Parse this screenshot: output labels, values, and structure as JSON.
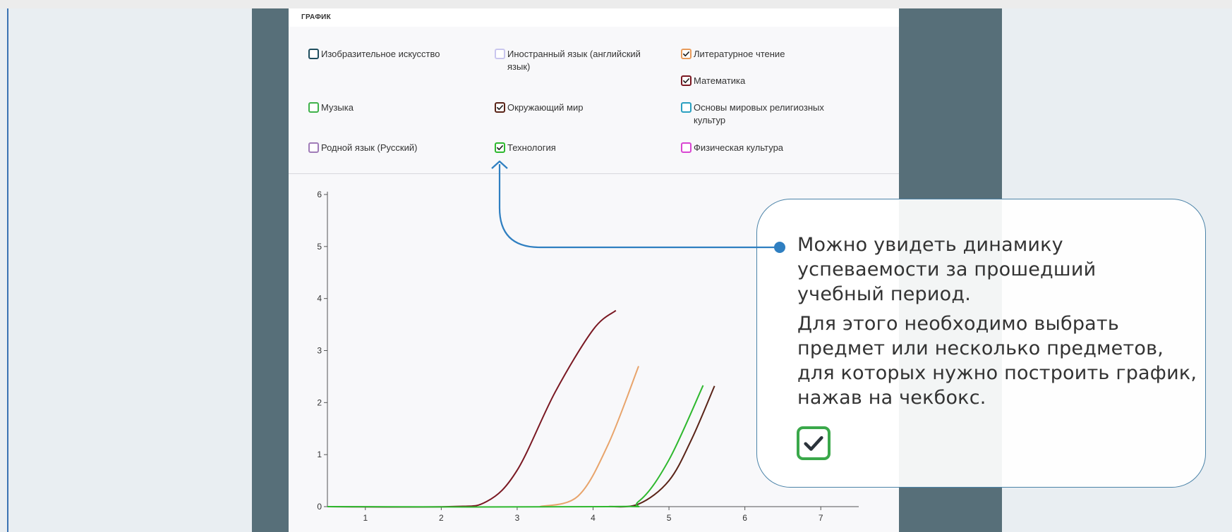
{
  "panel": {
    "title": "ГРАФИК"
  },
  "checkboxes": [
    {
      "label": "Изобразительное искусство",
      "checked": false,
      "color": "#1f4e5f"
    },
    {
      "label": "Иностранный язык (английский язык)",
      "checked": false,
      "color": "#c9c6ee"
    },
    {
      "label": "Литературное чтение",
      "checked": true,
      "color": "#e89b5b"
    },
    {
      "label": "Математика",
      "checked": true,
      "color": "#7a1822"
    },
    {
      "label": "Музыка",
      "checked": false,
      "color": "#3fb24a"
    },
    {
      "label": "Окружающий мир",
      "checked": true,
      "color": "#5a2418"
    },
    {
      "label": "Основы мировых религиозных культур",
      "checked": false,
      "color": "#2aa0c0"
    },
    {
      "label": "Родной язык (Русский)",
      "checked": false,
      "color": "#a07cb8"
    },
    {
      "label": "Технология",
      "checked": true,
      "color": "#2eb82e"
    },
    {
      "label": "Физическая культура",
      "checked": false,
      "color": "#d946d2"
    }
  ],
  "chart_data": {
    "type": "line",
    "xlim": [
      0.5,
      7.5
    ],
    "ylim": [
      0,
      6
    ],
    "x_ticks": [
      1,
      2,
      3,
      4,
      5,
      6,
      7
    ],
    "y_ticks": [
      0,
      1,
      2,
      3,
      4,
      5,
      6
    ],
    "series": [
      {
        "color": "#7a1822",
        "x": [
          0.5,
          2.1,
          2.6,
          3.0,
          3.5,
          4.0,
          4.3
        ],
        "y": [
          0,
          0,
          0.1,
          0.7,
          2.2,
          3.4,
          3.77
        ]
      },
      {
        "color": "#e8a46b",
        "x": [
          3.3,
          3.8,
          4.2,
          4.6
        ],
        "y": [
          0,
          0.2,
          1.2,
          2.7
        ]
      },
      {
        "color": "#5a2418",
        "x": [
          4.2,
          4.6,
          5.0,
          5.3,
          5.6
        ],
        "y": [
          0,
          0.05,
          0.5,
          1.3,
          2.32
        ]
      },
      {
        "color": "#2eb82e",
        "x": [
          0.5,
          4.2,
          4.6,
          5.0,
          5.45
        ],
        "y": [
          0,
          0,
          0.1,
          0.9,
          2.33
        ]
      }
    ]
  },
  "callout": {
    "line1": "Можно увидеть динамику",
    "line2": "успеваемости за прошедший",
    "line3": "учебный период.",
    "line4": "Для этого необходимо выбрать",
    "line5": "предмет или несколько предметов,",
    "line6": "для которых нужно построить график,",
    "line7": "нажав на чекбокс.",
    "accent_color": "#2f7fc1",
    "check_color": "#3aa84a"
  }
}
